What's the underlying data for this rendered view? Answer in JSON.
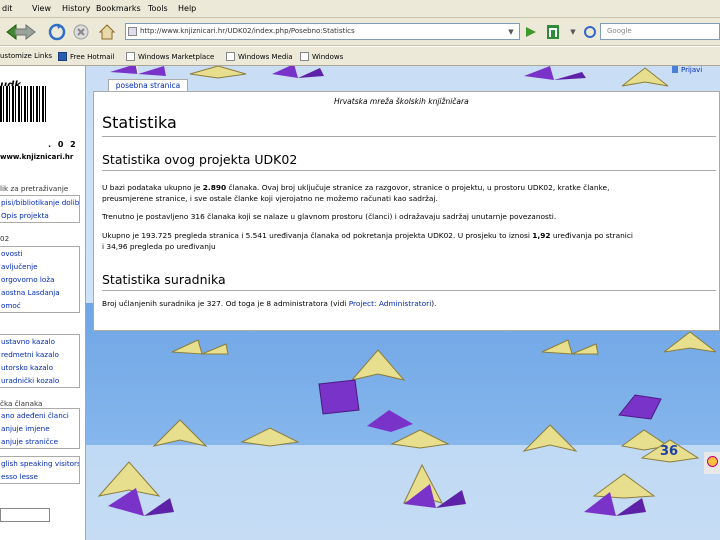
{
  "menu": {
    "items": [
      "dit",
      "View",
      "History",
      "Bookmarks",
      "Tools",
      "Help"
    ]
  },
  "nav": {
    "url": "http://www.knjiznicari.hr/UDK02/index.php/Posebno:Statistics",
    "search_placeholder": "Google"
  },
  "bookmarks": {
    "items": [
      "ustomize Links",
      "Free Hotmail",
      "Windows Marketplace",
      "Windows Media",
      "Windows"
    ]
  },
  "sidebar": {
    "logo_text": "udk",
    "barcode_number": ". 0 2",
    "site": "www.knjiznicari.hr",
    "head1": "lik za pretraživanje",
    "group1": [
      "pisi/bibliotikanje dolibeva",
      "Opis projekta"
    ],
    "head2": "02",
    "group2": [
      "ovosti",
      "avljučenje",
      "orgovorno loža",
      "aostna Lasdanja",
      "omoć"
    ],
    "group3": [
      "ustavno kazalo",
      "redmetni kazalo",
      "utorsko kazalo",
      "uradnički kozalo"
    ],
    "head3": "čka članaka",
    "group4": [
      "ano adeđeni članci",
      "anjuje imjene",
      "anjuje straničce"
    ],
    "group5": [
      "glish speaking visitors",
      "esso lesse"
    ]
  },
  "user": {
    "link": "Prijavi"
  },
  "content": {
    "tab": "posebna stranica",
    "site_heading": "Hrvatska mreža školskih knjižničara",
    "title": "Statistika",
    "h2_project": "Statistika ovog projekta UDK02",
    "p1_a": "U bazi podataka ukupno je ",
    "p1_num": "2.890",
    "p1_b": " članaka. Ovaj broj uključuje stranice za razgovor, stranice o projektu, u prostoru UDK02, kratke članke,",
    "p1_c": "preusmjerene stranice, i sve ostale članke koji vjerojatno ne možemo računati kao sadržaj.",
    "p2": "Trenutno je postavljeno 316 članaka koji se nalaze u glavnom prostoru (članci) i odražavaju sadržaj unutarnje povezanosti.",
    "p3_a": "Ukupno je 193.725 pregleda stranica i 5.541 uređivanja članaka od pokretanja projekta UDK02. U prosjeku to iznosi ",
    "p3_num": "1,92",
    "p3_b": " uređivanja po stranici",
    "p3_c": "i 34,96 pregleda po uređivanju",
    "h2_users": "Statistika suradnika",
    "p4_a": "Broj učlanjenih suradnika je 327. Od toga je 8 administratora (vidi ",
    "p4_link": "Project: Administratori",
    "p4_b": ")."
  },
  "slide": {
    "page_number": "36"
  },
  "colors": {
    "link": "#002bb8",
    "book_purple": "#7a33c9",
    "book_yellow": "#e7df8e",
    "page_number": "#1a3fa8"
  }
}
